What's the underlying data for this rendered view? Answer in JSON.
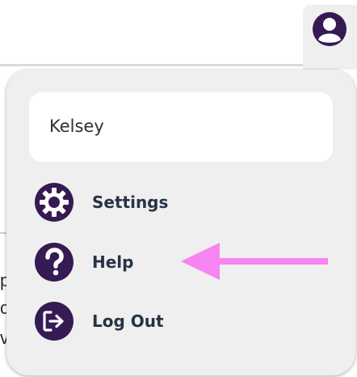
{
  "user": {
    "name": "Kelsey"
  },
  "menu": {
    "items": [
      {
        "label": "Settings",
        "icon": "gear-icon"
      },
      {
        "label": "Help",
        "icon": "question-icon"
      },
      {
        "label": "Log Out",
        "icon": "logout-icon"
      }
    ]
  },
  "background": {
    "fragments": [
      "p",
      "c",
      "v"
    ]
  },
  "colors": {
    "icon": "#361a53",
    "label": "#263344",
    "menu_bg": "#efeff0",
    "annotation_arrow": "#f884f2"
  }
}
